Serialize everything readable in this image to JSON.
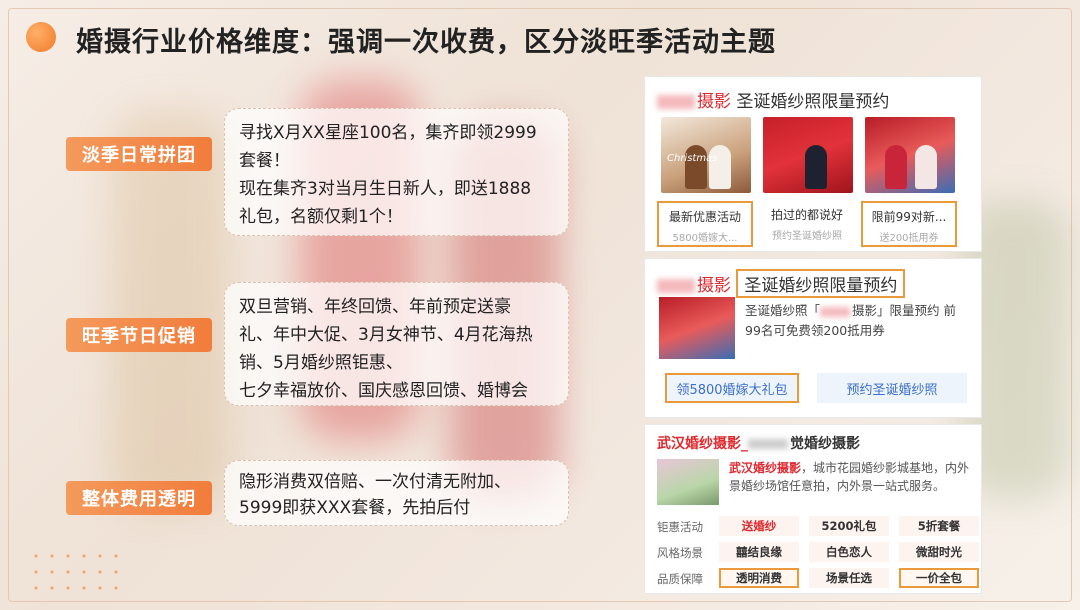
{
  "title": "婚摄行业价格维度：强调一次收费，区分淡旺季活动主题",
  "sections": [
    {
      "tag": "淡季日常拼团",
      "text": "寻找X月XX星座100名，集齐即领2999\n套餐！\n现在集齐3对当月生日新人，即送1888\n礼包，名额仅剩1个！"
    },
    {
      "tag": "旺季节日促销",
      "text": "双旦营销、年终回馈、年前预定送豪\n礼、年中大促、3月女神节、4月花海热\n销、5月婚纱照钜惠、\n七夕幸福放价、国庆感恩回馈、婚博会"
    },
    {
      "tag": "整体费用透明",
      "text": "隐形消费双倍赔、一次付清无附加、\n5999即获XXX套餐，先拍后付"
    }
  ],
  "panel1": {
    "brand_suffix": "摄影",
    "headline": "圣诞婚纱照限量预约",
    "thumb1_text": "Christmas",
    "cards": [
      {
        "title": "最新优惠活动",
        "sub": "5800婚嫁大..."
      },
      {
        "title": "拍过的都说好",
        "sub": "预约圣诞婚纱照"
      },
      {
        "title": "限前99对新...",
        "sub": "送200抵用券"
      }
    ]
  },
  "panel2": {
    "brand_suffix": "摄影",
    "headline": "圣诞婚纱照限量预约",
    "desc_a": "圣诞婚纱照「",
    "desc_b": "摄影」限量预约 前99名可免费领200抵用券",
    "btn_left": "领5800婚嫁大礼包",
    "btn_right": "预约圣诞婚纱照"
  },
  "panel3": {
    "headline_red": "武汉婚纱摄影_",
    "headline_rest": "觉婚纱摄影",
    "desc_red": "武汉婚纱摄影",
    "desc_rest": "，城市花园婚纱影城基地，内外景婚纱场馆任意拍，内外景一站式服务。",
    "rows": [
      {
        "label": "钜惠活动",
        "chips": [
          "送婚纱",
          "5200礼包",
          "5折套餐"
        ]
      },
      {
        "label": "风格场景",
        "chips": [
          "囍结良缘",
          "白色恋人",
          "微甜时光"
        ]
      },
      {
        "label": "品质保障",
        "chips": [
          "透明消费",
          "场景任选",
          "一价全包"
        ]
      }
    ]
  },
  "colors": {
    "accent": "#f27c3b",
    "highlight_border": "#e89a3c",
    "brand_red": "#e0292f"
  }
}
